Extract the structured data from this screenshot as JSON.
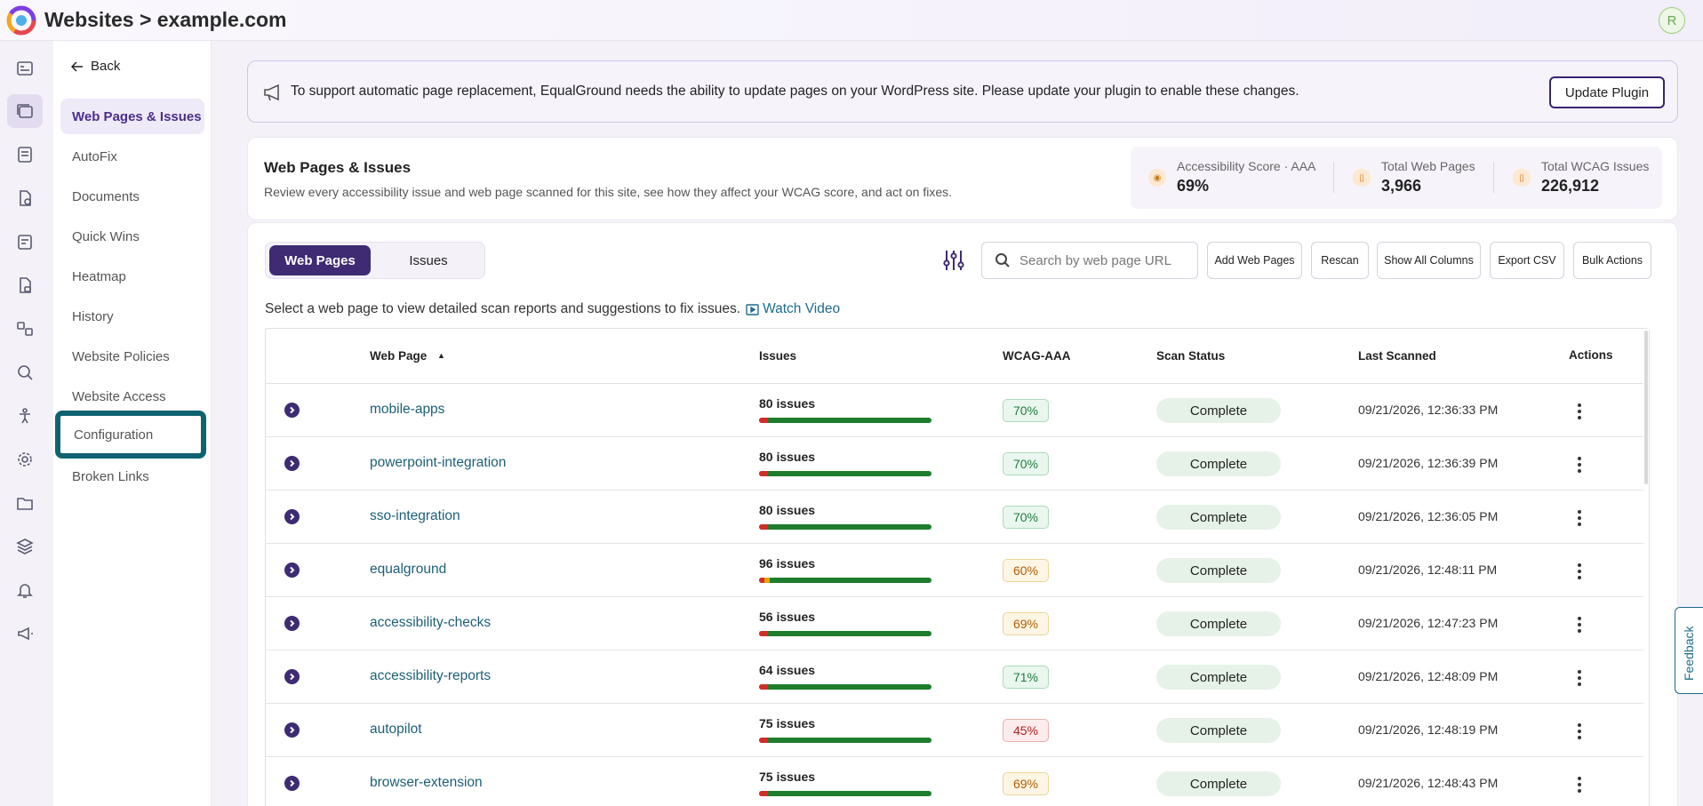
{
  "header": {
    "title": "Websites > example.com",
    "avatar_initial": "R"
  },
  "nav": {
    "back_label": "Back",
    "items": [
      {
        "label": "Web Pages & Issues"
      },
      {
        "label": "AutoFix"
      },
      {
        "label": "Documents"
      },
      {
        "label": "Quick Wins"
      },
      {
        "label": "Heatmap"
      },
      {
        "label": "History"
      },
      {
        "label": "Website Policies"
      },
      {
        "label": "Website Access"
      },
      {
        "label": "Configuration"
      },
      {
        "label": "Broken Links"
      }
    ]
  },
  "banner": {
    "text": "To support automatic page replacement, EqualGround needs the ability to update pages on your WordPress site. Please update your plugin to enable these changes.",
    "button_label": "Update Plugin"
  },
  "summary": {
    "title": "Web Pages & Issues",
    "description": "Review every accessibility issue and web page scanned for this site, see how they affect your WCAG score, and act on fixes.",
    "stats": [
      {
        "label": "Accessibility Score · AAA",
        "value": "69%"
      },
      {
        "label": "Total Web Pages",
        "value": "3,966"
      },
      {
        "label": "Total WCAG Issues",
        "value": "226,912"
      }
    ]
  },
  "toolbar": {
    "tab_web_pages": "Web Pages",
    "tab_issues": "Issues",
    "search_placeholder": "Search by web page URL",
    "add_label": "Add Web Pages",
    "rescan_label": "Rescan",
    "show_columns_label": "Show All Columns",
    "export_label": "Export CSV",
    "bulk_label": "Bulk Actions"
  },
  "helper": {
    "text": "Select a web page to view detailed scan reports and suggestions to fix issues.",
    "watch_label": "Watch Video"
  },
  "table": {
    "columns": {
      "web_page": "Web Page",
      "sort_arrow": "▲",
      "issues": "Issues",
      "wcag": "WCAG-AAA",
      "status": "Scan Status",
      "last_scanned": "Last Scanned",
      "actions": "Actions"
    },
    "rows": [
      {
        "page": "mobile-apps",
        "issues": "80 issues",
        "wcag": "70%",
        "status": "Complete",
        "last_scanned": "09/21/2026, 12:36:33 PM",
        "red": 0.05,
        "yellow": 0
      },
      {
        "page": "powerpoint-integration",
        "issues": "80 issues",
        "wcag": "70%",
        "status": "Complete",
        "last_scanned": "09/21/2026, 12:36:39 PM",
        "red": 0.05,
        "yellow": 0
      },
      {
        "page": "sso-integration",
        "issues": "80 issues",
        "wcag": "70%",
        "status": "Complete",
        "last_scanned": "09/21/2026, 12:36:05 PM",
        "red": 0.05,
        "yellow": 0
      },
      {
        "page": "equalground",
        "issues": "96 issues",
        "wcag": "60%",
        "status": "Complete",
        "last_scanned": "09/21/2026, 12:48:11 PM",
        "red": 0.03,
        "yellow": 0.03
      },
      {
        "page": "accessibility-checks",
        "issues": "56 issues",
        "wcag": "69%",
        "status": "Complete",
        "last_scanned": "09/21/2026, 12:47:23 PM",
        "red": 0.05,
        "yellow": 0
      },
      {
        "page": "accessibility-reports",
        "issues": "64 issues",
        "wcag": "71%",
        "status": "Complete",
        "last_scanned": "09/21/2026, 12:48:09 PM",
        "red": 0.05,
        "yellow": 0
      },
      {
        "page": "autopilot",
        "issues": "75 issues",
        "wcag": "45%",
        "status": "Complete",
        "last_scanned": "09/21/2026, 12:48:19 PM",
        "red": 0.05,
        "yellow": 0
      },
      {
        "page": "browser-extension",
        "issues": "75 issues",
        "wcag": "69%",
        "status": "Complete",
        "last_scanned": "09/21/2026, 12:48:43 PM",
        "red": 0.05,
        "yellow": 0
      }
    ]
  },
  "feedback_label": "Feedback",
  "colors": {
    "brand": "#3e2b73",
    "focus_ring": "#0f6371",
    "link": "#1c5f78",
    "bar_green": "#1e7d2c",
    "bar_red": "#d42b2b"
  }
}
